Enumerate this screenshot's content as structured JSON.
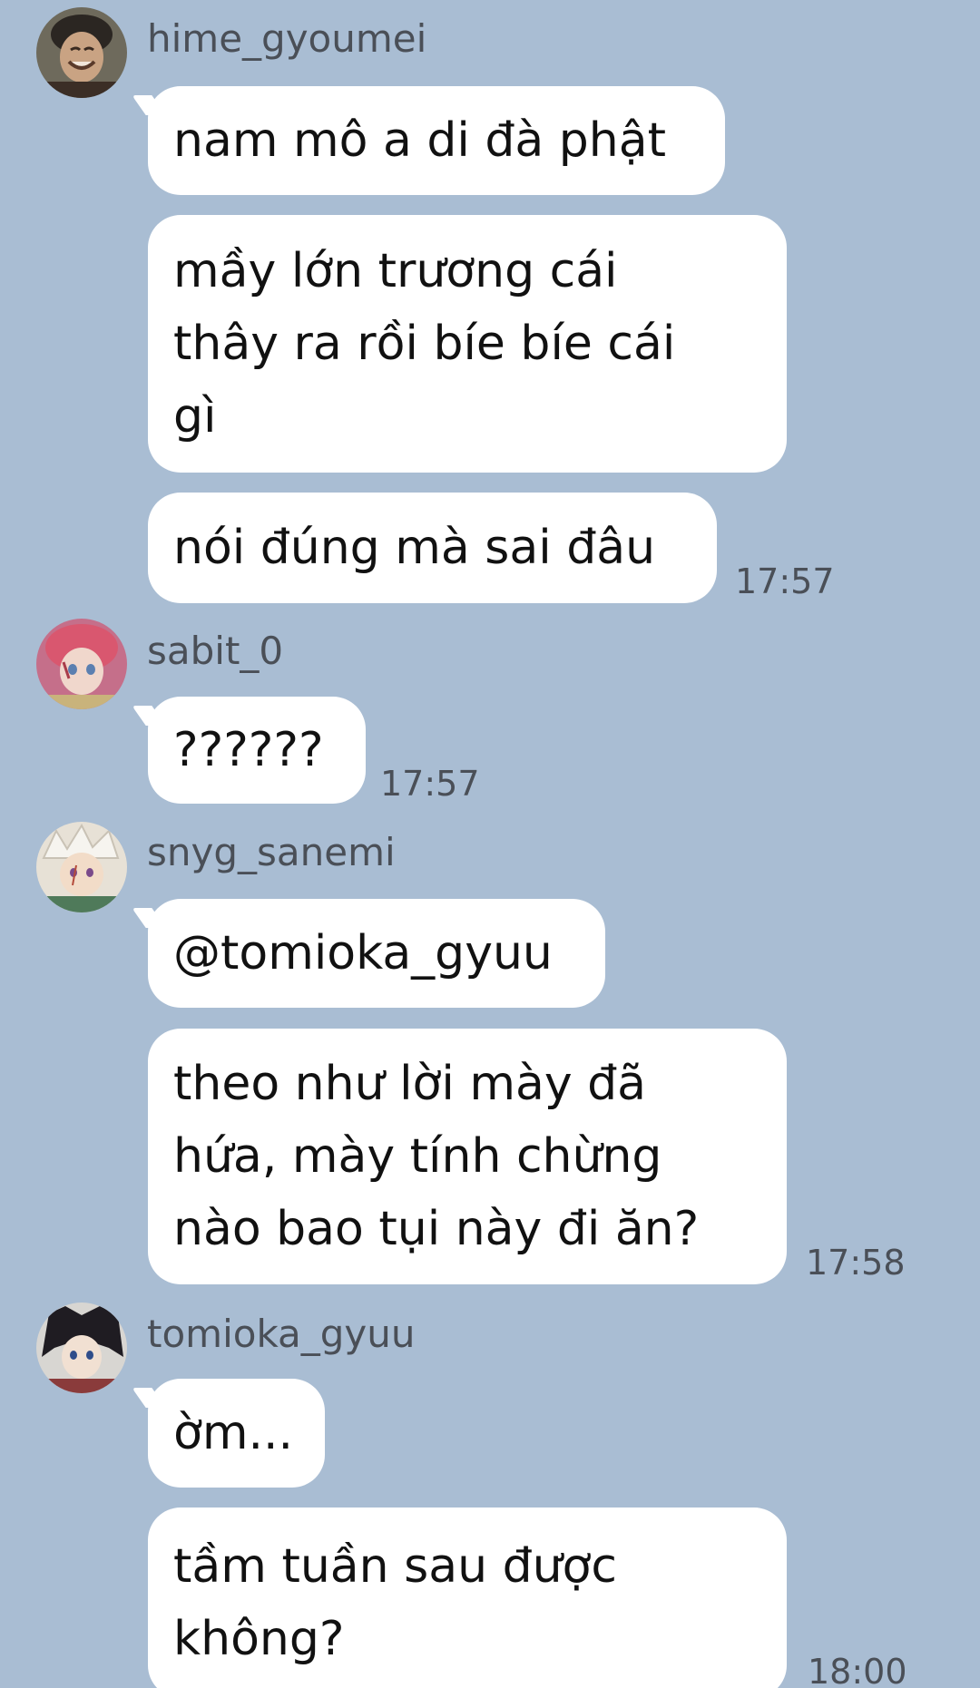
{
  "messages": [
    {
      "sender": "hime_gyoumei",
      "avatar_icon": "avatar-hime-gyoumei",
      "bubbles": [
        "nam mô a di đà phật",
        "mầy lớn trương cái\nthây ra rồi bíe bíe cái\ngì",
        "nói đúng mà sai đâu"
      ],
      "time": "17:57"
    },
    {
      "sender": "sabit_0",
      "avatar_icon": "avatar-sabit-0",
      "bubbles": [
        "??????"
      ],
      "time": "17:57"
    },
    {
      "sender": "snyg_sanemi",
      "avatar_icon": "avatar-snyg-sanemi",
      "bubbles": [
        "@tomioka_gyuu",
        "theo như lời mày đã\nhứa, mày tính chừng\nnào bao tụi này đi ăn?"
      ],
      "time": "17:58"
    },
    {
      "sender": "tomioka_gyuu",
      "avatar_icon": "avatar-tomioka-gyuu",
      "bubbles": [
        "ờm...",
        "tầm tuần sau được\nkhông?"
      ],
      "time": "18:00"
    }
  ],
  "colors": {
    "background": "#a9bdd3",
    "bubble": "#ffffff",
    "meta_text": "#4a4f57",
    "message_text": "#111111"
  }
}
